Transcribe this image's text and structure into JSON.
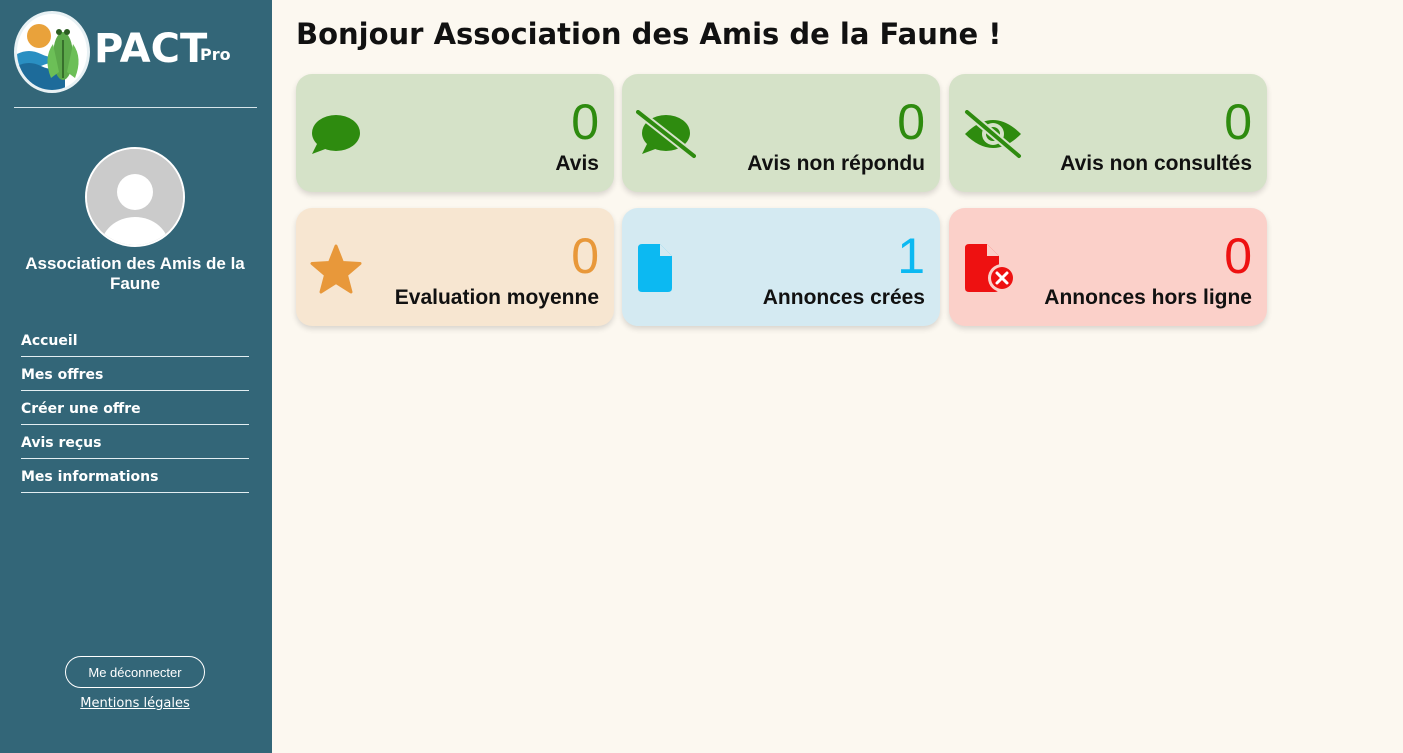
{
  "brand": {
    "name": "PACT",
    "sub": "Pro"
  },
  "user": {
    "name": "Association des Amis de la Faune"
  },
  "nav": {
    "items": [
      {
        "label": "Accueil"
      },
      {
        "label": "Mes offres"
      },
      {
        "label": "Créer une offre"
      },
      {
        "label": "Avis reçus"
      },
      {
        "label": "Mes informations"
      }
    ]
  },
  "footer": {
    "logout_label": "Me déconnecter",
    "legal_label": "Mentions légales"
  },
  "main": {
    "title": "Bonjour Association des Amis de la Faune !"
  },
  "stats": [
    {
      "value": "0",
      "label": "Avis",
      "icon": "comment-icon",
      "color": "#2e8b0f",
      "bg": "#d5e2c8"
    },
    {
      "value": "0",
      "label": "Avis non répondu",
      "icon": "comment-slash-icon",
      "color": "#2e8b0f",
      "bg": "#d5e2c8"
    },
    {
      "value": "0",
      "label": "Avis non consultés",
      "icon": "eye-slash-icon",
      "color": "#2e8b0f",
      "bg": "#d5e2c8"
    },
    {
      "value": "0",
      "label": "Evaluation moyenne",
      "icon": "star-icon",
      "color": "#e8983a",
      "bg": "#f7e6d1"
    },
    {
      "value": "1",
      "label": "Annonces crées",
      "icon": "document-icon",
      "color": "#0cb9f2",
      "bg": "#d4eaf2"
    },
    {
      "value": "0",
      "label": "Annonces hors ligne",
      "icon": "document-offline-icon",
      "color": "#ee1111",
      "bg": "#fbd0c9"
    }
  ]
}
